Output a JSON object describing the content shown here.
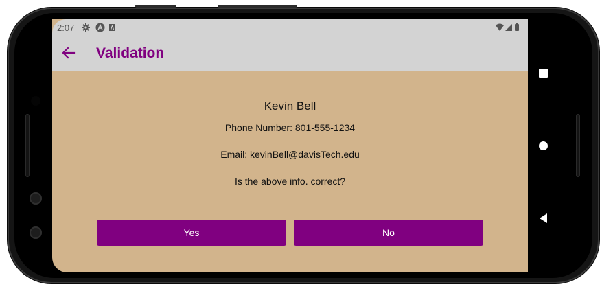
{
  "status_bar": {
    "time": "2:07",
    "left_icons": [
      "gear-icon",
      "android-a-icon",
      "a-box-icon"
    ],
    "right_icons": [
      "wifi-icon",
      "signal-icon",
      "battery-icon"
    ]
  },
  "app_bar": {
    "title": "Validation",
    "back_icon": "arrow-left-icon"
  },
  "details": {
    "name": "Kevin Bell",
    "phone": "Phone Number: 801-555-1234",
    "email": "Email: kevinBell@davisTech.edu",
    "question": "Is the above info. correct?"
  },
  "buttons": {
    "yes": "Yes",
    "no": "No"
  },
  "nav": [
    "recents-square-icon",
    "home-circle-icon",
    "back-triangle-icon"
  ],
  "colors": {
    "accent": "#800080",
    "background": "#d2b48c",
    "app_bar": "#d3d3d3"
  }
}
